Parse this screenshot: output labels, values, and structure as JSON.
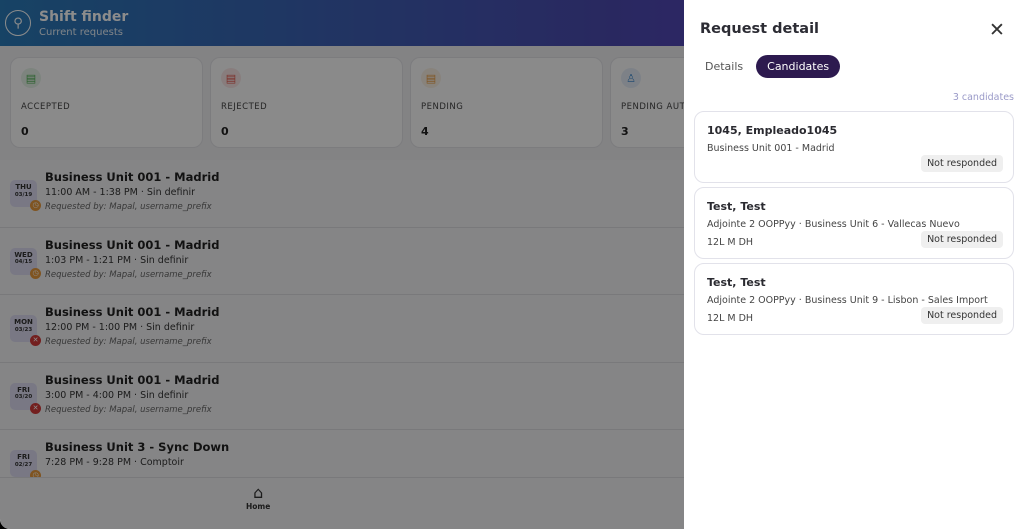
{
  "header": {
    "title": "Shift finder",
    "subtitle": "Current requests",
    "logo_icon": "org-tree-icon",
    "gradient": [
      "#2a7ab8",
      "#6a3ad0"
    ]
  },
  "stats": [
    {
      "label": "ACCEPTED",
      "value": "0",
      "icon": "document-check-icon",
      "color": "#4caf50"
    },
    {
      "label": "REJECTED",
      "value": "0",
      "icon": "document-x-icon",
      "color": "#e0524a"
    },
    {
      "label": "PENDING",
      "value": "4",
      "icon": "document-clock-icon",
      "color": "#e89a3c"
    },
    {
      "label": "PENDING AUT",
      "value": "3",
      "icon": "user-clock-icon",
      "color": "#4a90d0"
    }
  ],
  "requests": [
    {
      "day": "THU",
      "date": "03/19",
      "status": "pending",
      "title": "Business Unit 001 - Madrid",
      "time": "11:00 AM - 1:38 PM · Sin definir",
      "requested_by": "Requested by: Mapal, username_prefix"
    },
    {
      "day": "WED",
      "date": "04/15",
      "status": "pending",
      "title": "Business Unit 001 - Madrid",
      "time": "1:03 PM - 1:21 PM · Sin definir",
      "requested_by": "Requested by: Mapal, username_prefix"
    },
    {
      "day": "MON",
      "date": "03/23",
      "status": "rejected",
      "title": "Business Unit 001 - Madrid",
      "time": "12:00 PM - 1:00 PM · Sin definir",
      "requested_by": "Requested by: Mapal, username_prefix"
    },
    {
      "day": "FRI",
      "date": "03/20",
      "status": "rejected",
      "title": "Business Unit 001 - Madrid",
      "time": "3:00 PM - 4:00 PM · Sin definir",
      "requested_by": "Requested by: Mapal, username_prefix"
    },
    {
      "day": "FRI",
      "date": "02/27",
      "status": "pending",
      "title": "Business Unit 3 - Sync Down",
      "time": "7:28 PM - 9:28 PM · Comptoir",
      "requested_by": ""
    }
  ],
  "nav": {
    "home_label": "Home"
  },
  "panel": {
    "title": "Request detail",
    "tabs": [
      "Details",
      "Candidates"
    ],
    "active_tab": "Candidates",
    "count_label": "3 candidates",
    "candidates": [
      {
        "name": "1045, Empleado1045",
        "unit": "Business Unit 001 - Madrid",
        "position": "",
        "status": "Not responded"
      },
      {
        "name": "Test, Test",
        "unit": "Adjointe 2 OOPPyy · Business Unit 6 - Vallecas Nuevo",
        "position": "12L M DH",
        "status": "Not responded"
      },
      {
        "name": "Test, Test",
        "unit": "Adjointe 2 OOPPyy · Business Unit 9 - Lisbon - Sales Import",
        "position": "12L M DH",
        "status": "Not responded"
      }
    ]
  }
}
